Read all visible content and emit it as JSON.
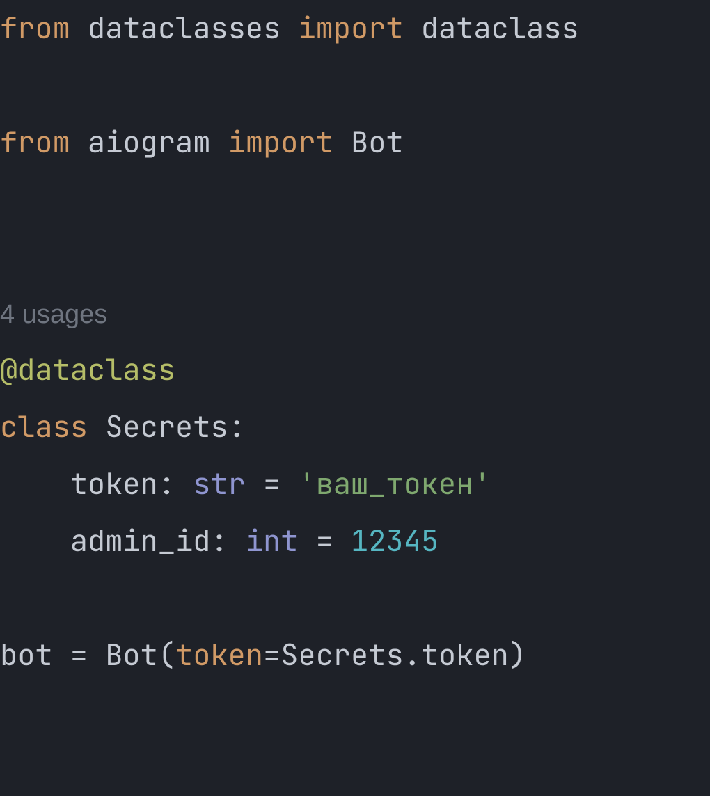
{
  "code": {
    "line1": {
      "kw_from": "from",
      "module": "dataclasses",
      "kw_import": "import",
      "name": "dataclass"
    },
    "line3": {
      "kw_from": "from",
      "module": "aiogram",
      "kw_import": "import",
      "name": "Bot"
    },
    "hint": "4 usages",
    "decorator": "@dataclass",
    "line7": {
      "kw_class": "class",
      "classname": "Secrets",
      "colon": ":"
    },
    "line8": {
      "indent": "    ",
      "field": "token",
      "colon1": ": ",
      "type": "str",
      "eq": " = ",
      "value": "'ваш_токен'"
    },
    "line9": {
      "indent": "    ",
      "field": "admin_id",
      "colon1": ": ",
      "type": "int",
      "eq": " = ",
      "value": "12345"
    },
    "line11": {
      "var": "bot",
      "eq": " = ",
      "call": "Bot",
      "lparen": "(",
      "param": "token",
      "assign": "=",
      "arg": "Secrets.token",
      "rparen": ")"
    }
  }
}
